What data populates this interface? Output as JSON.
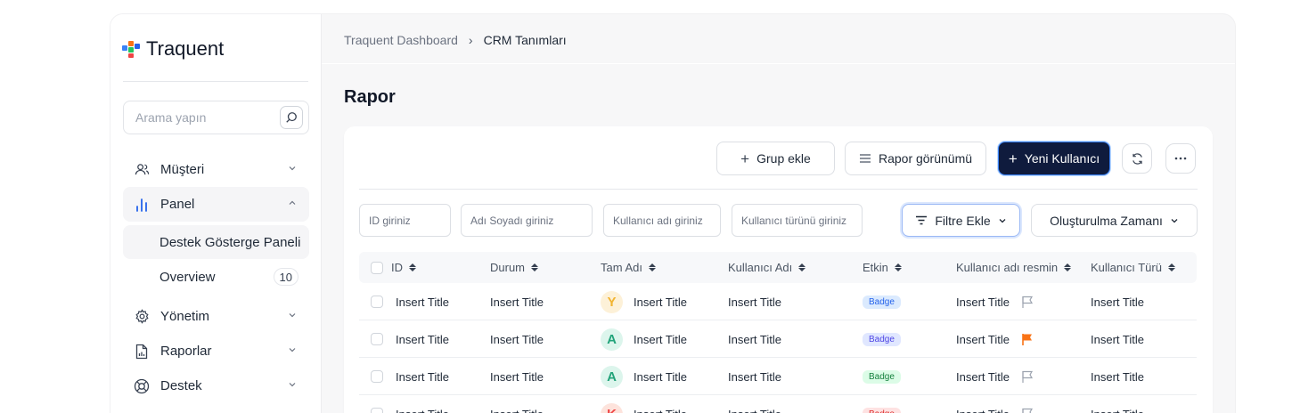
{
  "brand": {
    "name": "Traquent"
  },
  "search": {
    "placeholder": "Arama yapın"
  },
  "sidebar": {
    "items": [
      {
        "label": "Müşteri",
        "icon": "users-icon",
        "expanded": false
      },
      {
        "label": "Panel",
        "icon": "bar-chart-icon",
        "expanded": true,
        "children": [
          {
            "label": "Destek Gösterge Paneli",
            "selected": true
          },
          {
            "label": "Overview",
            "count": "10"
          }
        ]
      },
      {
        "label": "Yönetim",
        "icon": "gear-icon",
        "expanded": false
      },
      {
        "label": "Raporlar",
        "icon": "report-file-icon",
        "expanded": false
      },
      {
        "label": "Destek",
        "icon": "lifebuoy-icon",
        "expanded": false
      }
    ]
  },
  "breadcrumb": {
    "parent": "Traquent Dashboard",
    "separator": "›",
    "current": "CRM Tanımları"
  },
  "page": {
    "title": "Rapor"
  },
  "toolbar": {
    "group_add": "Grup ekle",
    "report_view": "Rapor görünümü",
    "new_user": "Yeni Kullanıcı"
  },
  "filters": {
    "id_placeholder": "ID giriniz",
    "name_placeholder": "Adı Soyadı giriniz",
    "username_placeholder": "Kullanıcı adı giriniz",
    "usertype_placeholder": "Kullanıcı türünü giriniz",
    "add_filter": "Filtre Ekle",
    "sort_by": "Oluşturulma Zamanı"
  },
  "table": {
    "columns": [
      "ID",
      "Durum",
      "Tam Adı",
      "Kullanıcı Adı",
      "Etkin",
      "Kullanıcı adı resmin",
      "Kullanıcı Türü"
    ],
    "rows": [
      {
        "id": "Insert Title",
        "status": "Insert Title",
        "avatar": "Y",
        "avatar_bg": "#fdf1d8",
        "avatar_fg": "#f2b431",
        "full_name": "Insert Title",
        "username": "Insert Title",
        "active": "Badge",
        "badge_bg": "#dbeafe",
        "badge_fg": "#2563eb",
        "image": "Insert Title",
        "flag": "outline",
        "user_type": "Insert Title"
      },
      {
        "id": "Insert Title",
        "status": "Insert Title",
        "avatar": "A",
        "avatar_bg": "#dcf5ec",
        "avatar_fg": "#22a37a",
        "full_name": "Insert Title",
        "username": "Insert Title",
        "active": "Badge",
        "badge_bg": "#e0e7ff",
        "badge_fg": "#4f46e5",
        "image": "Insert Title",
        "flag": "filled",
        "user_type": "Insert Title"
      },
      {
        "id": "Insert Title",
        "status": "Insert Title",
        "avatar": "A",
        "avatar_bg": "#dcf5ec",
        "avatar_fg": "#22a37a",
        "full_name": "Insert Title",
        "username": "Insert Title",
        "active": "Badge",
        "badge_bg": "#dcfce7",
        "badge_fg": "#15803d",
        "image": "Insert Title",
        "flag": "outline",
        "user_type": "Insert Title"
      },
      {
        "id": "Insert Title",
        "status": "Insert Title",
        "avatar": "K",
        "avatar_bg": "#fde3dc",
        "avatar_fg": "#ef4444",
        "full_name": "Insert Title",
        "username": "Insert Title",
        "active": "Badge",
        "badge_bg": "#fee2e2",
        "badge_fg": "#dc2626",
        "image": "Insert Title",
        "flag": "outline",
        "user_type": "Insert Title"
      }
    ]
  },
  "colors": {
    "primary": "#0f1b3d",
    "flag_filled": "#f97316",
    "flag_outline": "#9ca3af"
  }
}
